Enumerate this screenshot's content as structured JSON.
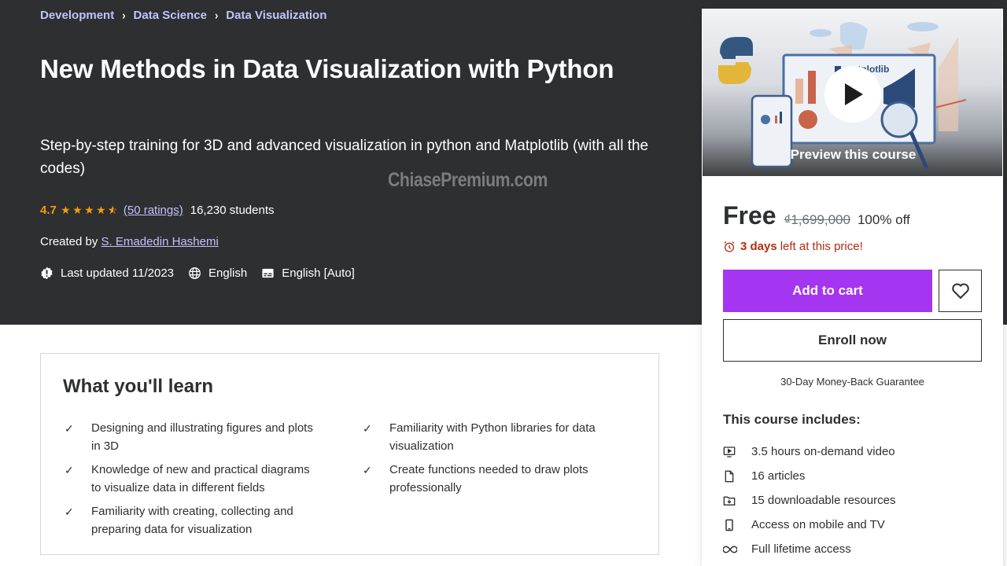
{
  "breadcrumb": [
    {
      "label": "Development"
    },
    {
      "label": "Data Science"
    },
    {
      "label": "Data Visualization"
    }
  ],
  "breadcrumb_separator": "›",
  "course": {
    "title": "New Methods in Data Visualization with Python",
    "subtitle": "Step-by-step training for 3D and advanced visualization in python and Matplotlib (with all the codes)",
    "rating": "4.7",
    "rating_stars": 4.5,
    "ratings_link": "(50 ratings)",
    "students": "16,230 students",
    "created_by_label": "Created by",
    "author": "S. Emadedin Hashemi",
    "last_updated": "Last updated 11/2023",
    "language": "English",
    "captions": "English [Auto]"
  },
  "watermark": "ChiasePremium.com",
  "learn": {
    "title": "What you'll learn",
    "check_glyph": "✓",
    "left": [
      "Designing and illustrating figures and plots in 3D",
      "Knowledge of new and practical diagrams to visualize data in different fields",
      "Familiarity with creating, collecting and preparing data for visualization"
    ],
    "right": [
      "Familiarity with Python libraries for data visualization",
      "Create functions needed to draw plots professionally"
    ]
  },
  "sidebar": {
    "preview_label": "Preview this course",
    "price_now": "Free",
    "price_old": "₫1,699,000",
    "discount": "100% off",
    "deadline_bold": "3 days",
    "deadline_rest": "left at this price!",
    "add_to_cart": "Add to cart",
    "enroll_now": "Enroll now",
    "guarantee": "30-Day Money-Back Guarantee",
    "includes_title": "This course includes:",
    "includes": [
      {
        "icon": "video-icon",
        "label": "3.5 hours on-demand video"
      },
      {
        "icon": "article-icon",
        "label": "16 articles"
      },
      {
        "icon": "download-folder-icon",
        "label": "15 downloadable resources"
      },
      {
        "icon": "mobile-icon",
        "label": "Access on mobile and TV"
      },
      {
        "icon": "infinity-icon",
        "label": "Full lifetime access"
      }
    ]
  },
  "colors": {
    "hero_bg": "#2d2f31",
    "link": "#c0c4fc",
    "star": "#f69c08",
    "cta_purple": "#a435f0",
    "deadline_red": "#b32d0f"
  }
}
